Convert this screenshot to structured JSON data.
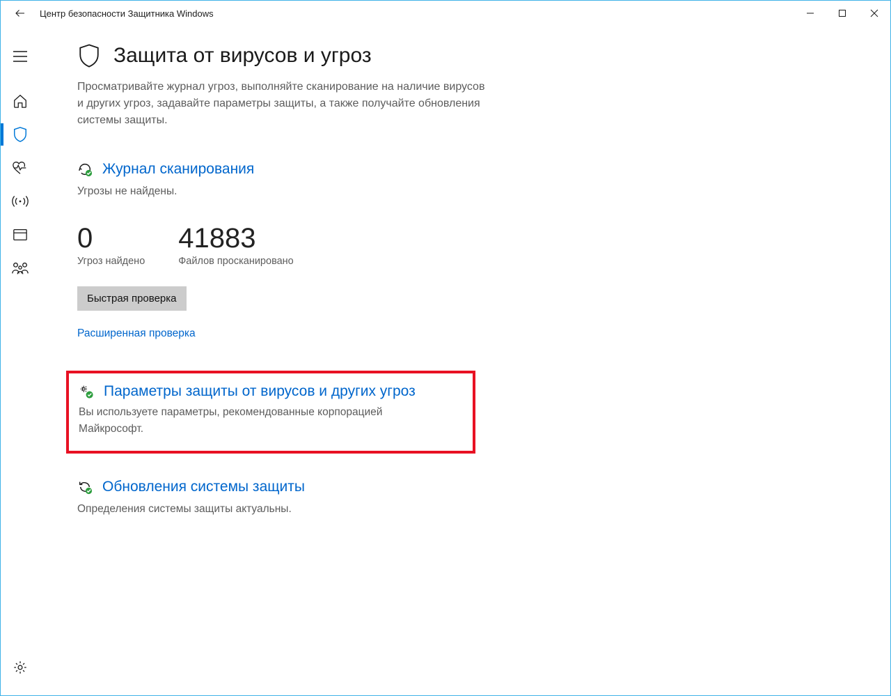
{
  "window": {
    "title": "Центр безопасности Защитника Windows"
  },
  "sidebar": {
    "items": [
      {
        "name": "menu"
      },
      {
        "name": "home"
      },
      {
        "name": "shield",
        "active": true
      },
      {
        "name": "heart"
      },
      {
        "name": "antenna"
      },
      {
        "name": "app-browser"
      },
      {
        "name": "family"
      }
    ]
  },
  "page": {
    "title": "Защита от вирусов и угроз",
    "description": "Просматривайте журнал угроз, выполняйте сканирование на наличие вирусов и других угроз, задавайте параметры защиты, а также получайте обновления системы защиты."
  },
  "scan": {
    "heading": "Журнал сканирования",
    "status": "Угрозы не найдены.",
    "threats_count": "0",
    "threats_label": "Угроз найдено",
    "files_count": "41883",
    "files_label": "Файлов просканировано",
    "quick_button": "Быстрая проверка",
    "advanced_link": "Расширенная проверка"
  },
  "settings": {
    "heading": "Параметры защиты от вирусов и других угроз",
    "description": "Вы используете параметры, рекомендованные корпорацией Майкрософт."
  },
  "updates": {
    "heading": "Обновления системы защиты",
    "description": "Определения системы защиты актуальны."
  }
}
